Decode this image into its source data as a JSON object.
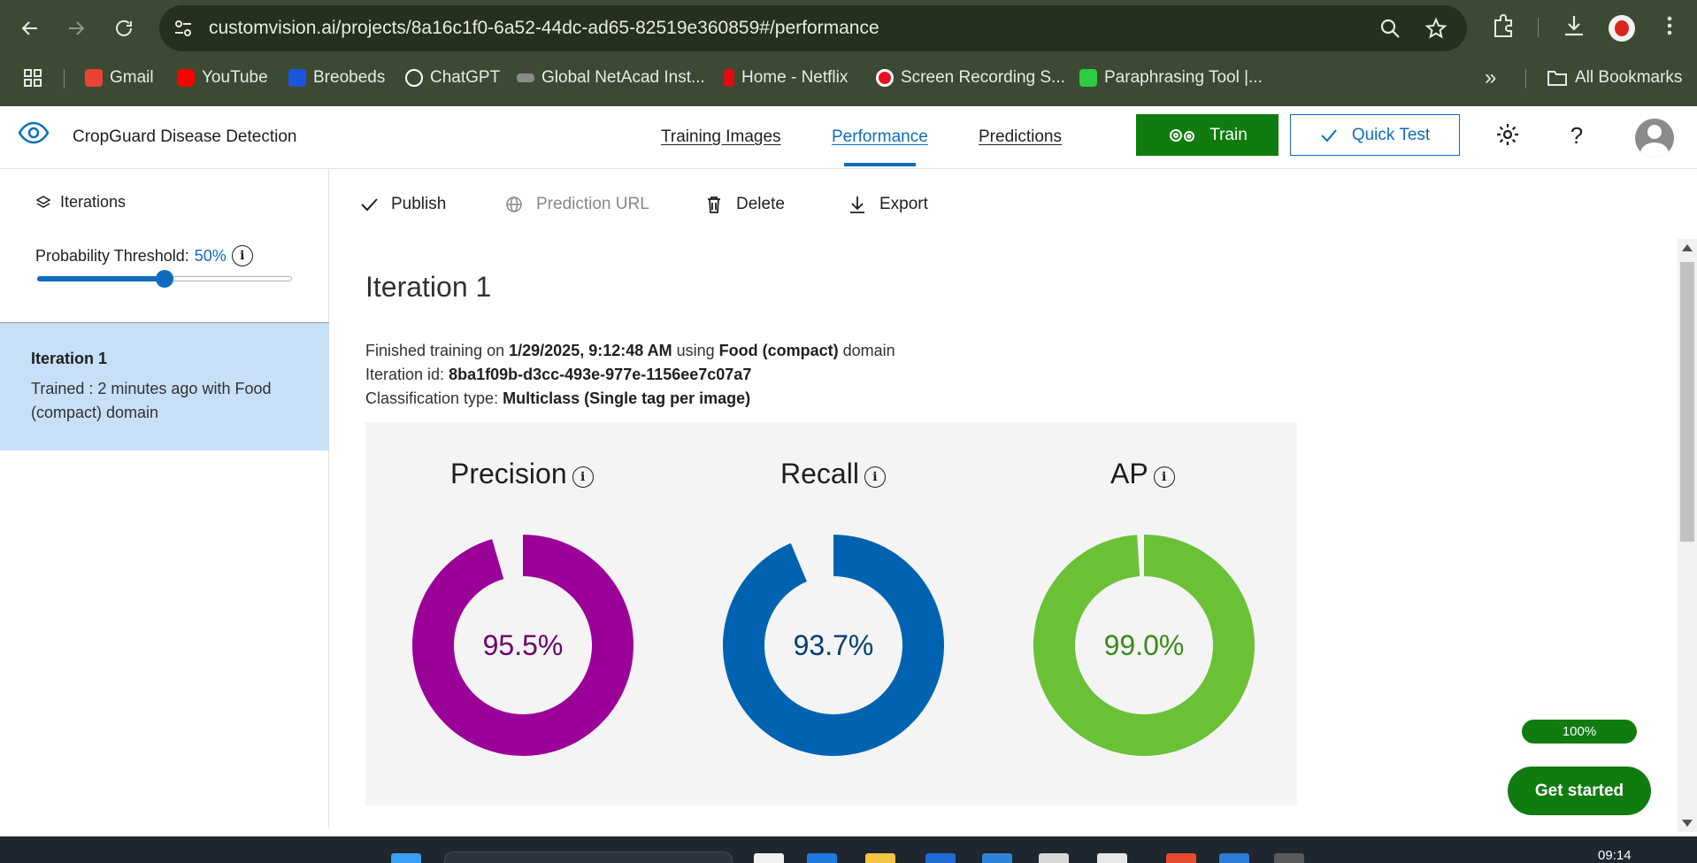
{
  "browser": {
    "url": "customvision.ai/projects/8a16c1f0-6a52-44dc-ad65-82519e360859#/performance",
    "bookmarks": [
      {
        "label": "Gmail",
        "color": "#ea4335"
      },
      {
        "label": "YouTube",
        "color": "#ff0000"
      },
      {
        "label": "Breobeds",
        "color": "#1a56db"
      },
      {
        "label": "ChatGPT",
        "color": "#ffffff"
      },
      {
        "label": "Global NetAcad Inst...",
        "color": "#8a8a8a"
      },
      {
        "label": "Home - Netflix",
        "color": "#e50914"
      },
      {
        "label": "Screen Recording S...",
        "color": "#ffffff"
      },
      {
        "label": "Paraphrasing Tool |...",
        "color": "#2ecc40"
      }
    ],
    "more_label": "»",
    "all_bookmarks": "All Bookmarks"
  },
  "header": {
    "project_title": "CropGuard Disease Detection",
    "tabs": [
      "Training Images",
      "Performance",
      "Predictions"
    ],
    "active_tab": "Performance",
    "train_label": "Train",
    "quick_test_label": "Quick Test"
  },
  "sidebar": {
    "iterations_label": "Iterations",
    "threshold_label": "Probability Threshold:",
    "threshold_value": "50%",
    "threshold_fraction": 0.5,
    "selected_iteration": {
      "name": "Iteration 1",
      "description": "Trained : 2 minutes ago with Food (compact) domain"
    }
  },
  "toolbar": {
    "publish": "Publish",
    "prediction_url": "Prediction URL",
    "delete": "Delete",
    "export": "Export"
  },
  "iteration": {
    "title": "Iteration 1",
    "finished_prefix": "Finished training on",
    "finished_date": "1/29/2025, 9:12:48 AM",
    "using_label": "using",
    "domain_name": "Food (compact)",
    "domain_suffix": "domain",
    "id_label": "Iteration id:",
    "id_value": "8ba1f09b-d3cc-493e-977e-1156ee7c07a7",
    "classification_label": "Classification type:",
    "classification_value": "Multiclass (Single tag per image)"
  },
  "metrics": [
    {
      "name": "Precision",
      "value": 95.5,
      "display": "95.5%",
      "color": "#9b0099",
      "text_color": "#6b006a"
    },
    {
      "name": "Recall",
      "value": 93.7,
      "display": "93.7%",
      "color": "#0063b1",
      "text_color": "#003f74"
    },
    {
      "name": "AP",
      "value": 99.0,
      "display": "99.0%",
      "color": "#6ac136",
      "text_color": "#3b8a1a"
    }
  ],
  "widgets": {
    "progress_label": "100%",
    "get_started": "Get started"
  },
  "taskbar": {
    "time": "09:14"
  }
}
